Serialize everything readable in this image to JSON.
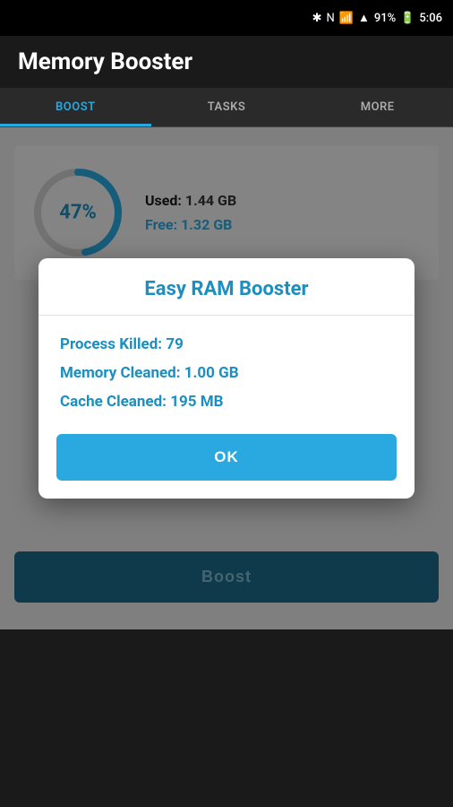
{
  "statusBar": {
    "battery": "91%",
    "time": "5:06",
    "icons": [
      "bluetooth",
      "n-signal",
      "wifi",
      "signal"
    ]
  },
  "header": {
    "title": "Memory Booster"
  },
  "tabs": [
    {
      "label": "BOOST",
      "active": true
    },
    {
      "label": "TASKS",
      "active": false
    },
    {
      "label": "MORE",
      "active": false
    }
  ],
  "memoryInfo": {
    "percent": "47%",
    "usedLabel": "Used:",
    "usedValue": "1.44 GB",
    "freeLabel": "Free:",
    "freeValue": "1.32 GB",
    "circlePercent": 47
  },
  "boostButton": {
    "label": "Boost"
  },
  "dialog": {
    "title": "Easy RAM Booster",
    "stats": [
      {
        "label": "Process Killed:",
        "value": "79"
      },
      {
        "label": "Memory Cleaned:",
        "value": "1.00 GB"
      },
      {
        "label": "Cache Cleaned:",
        "value": "195 MB"
      }
    ],
    "okLabel": "OK"
  }
}
